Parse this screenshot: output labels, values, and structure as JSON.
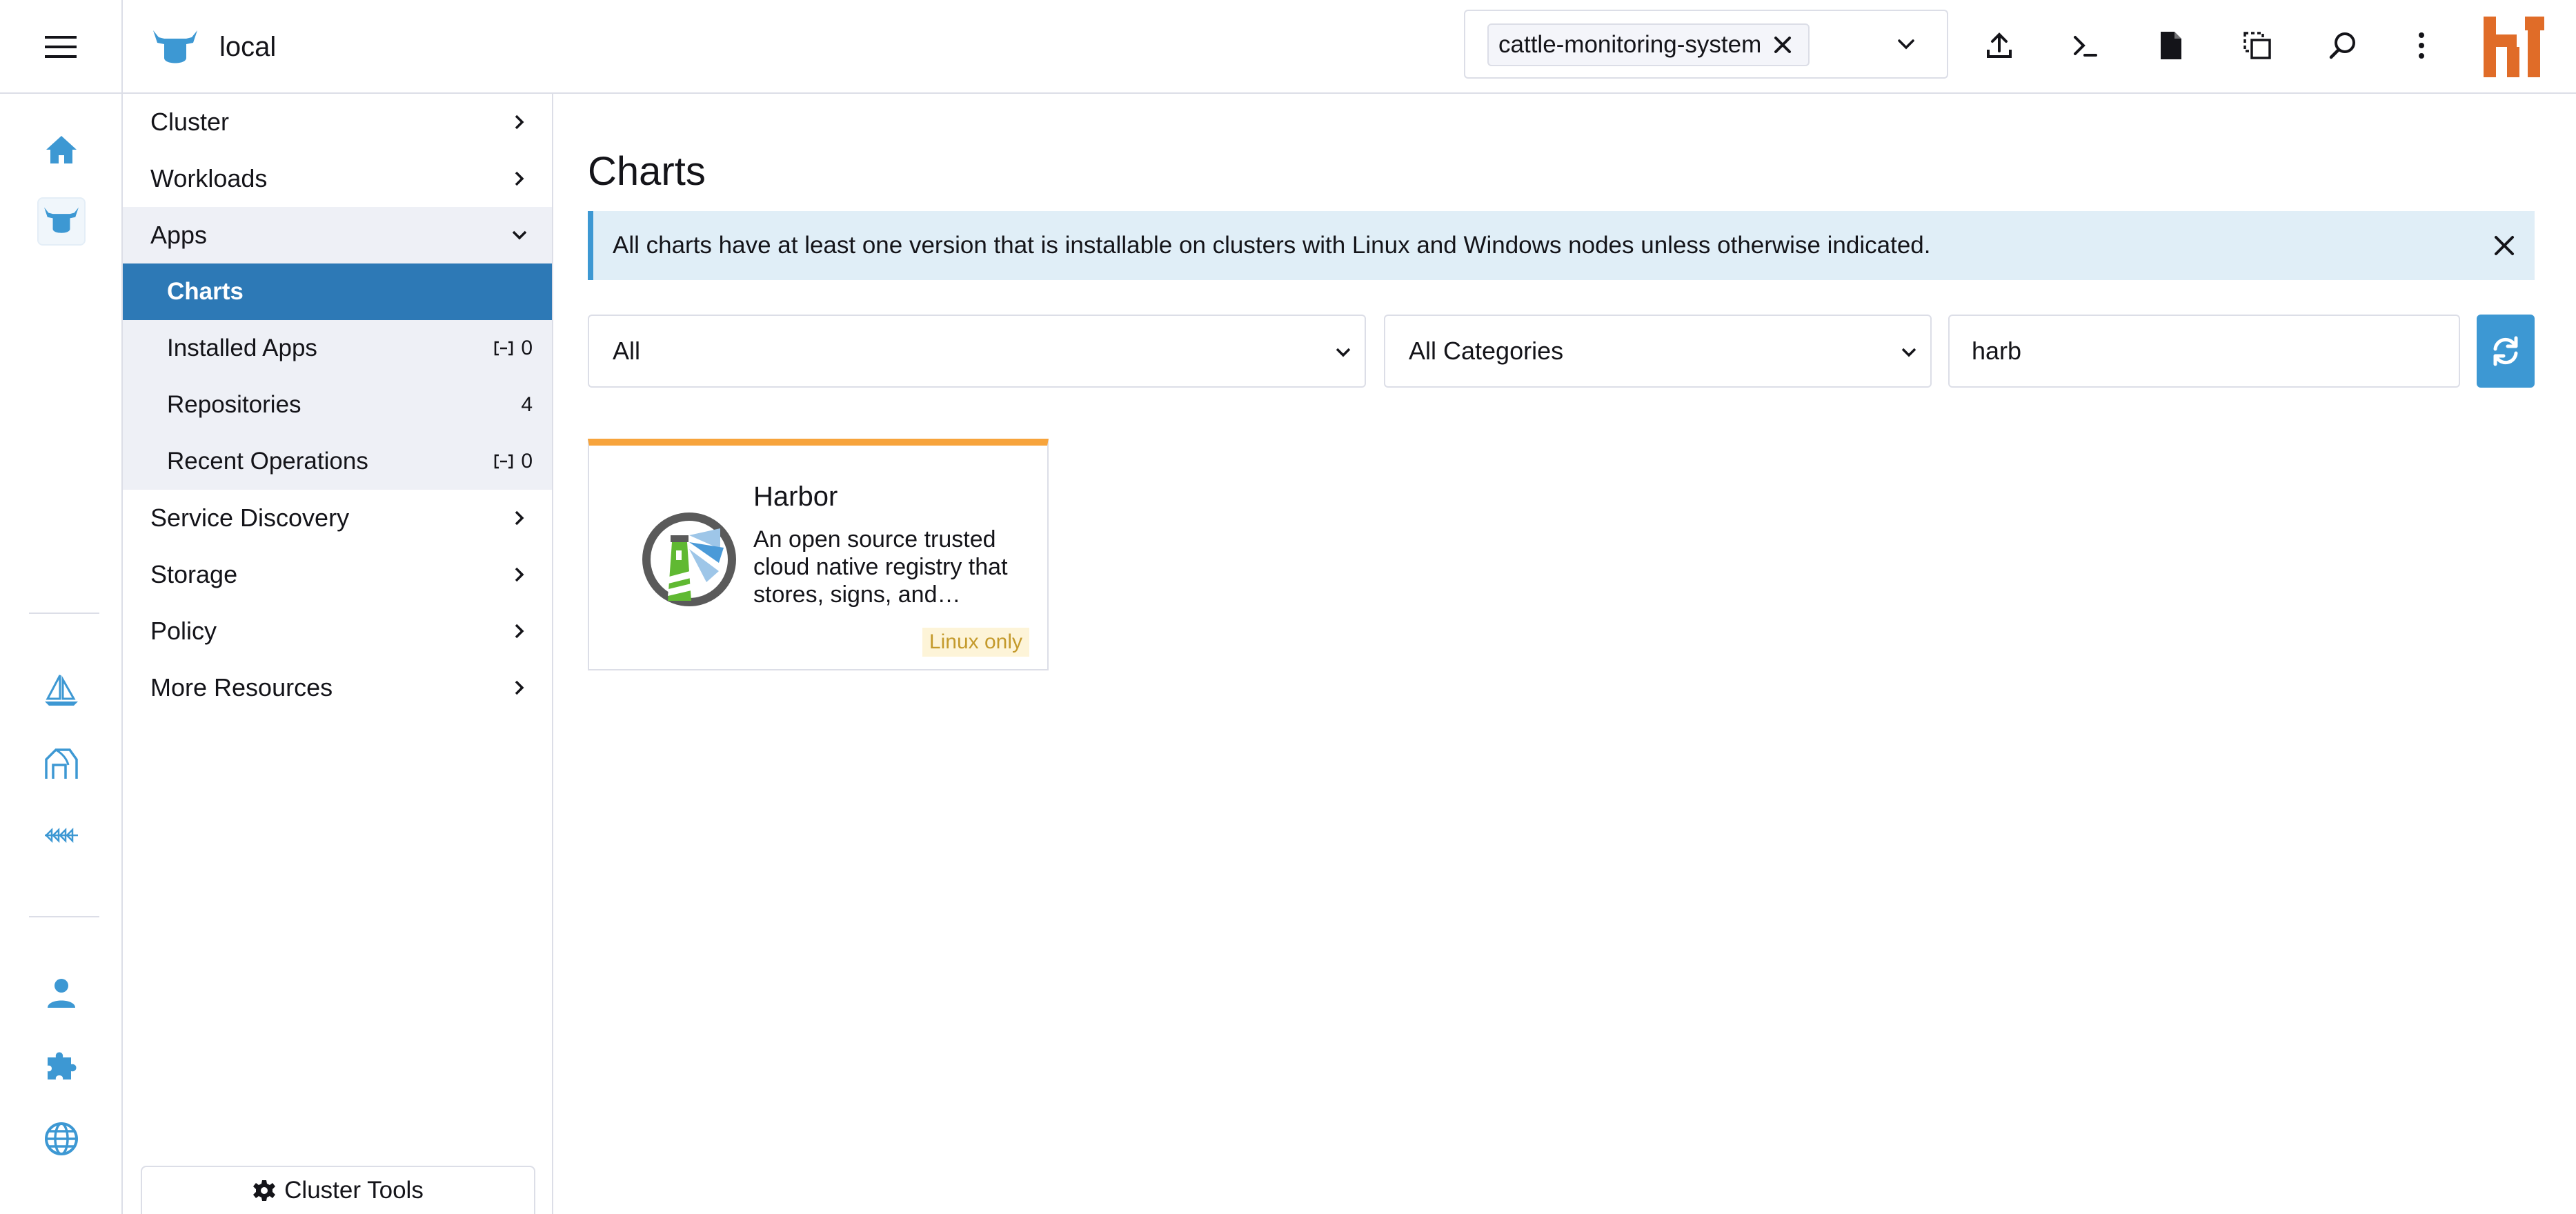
{
  "header": {
    "cluster_name": "local",
    "namespace_chip": "cattle-monitoring-system"
  },
  "sidebar": {
    "groups": [
      {
        "label": "Cluster"
      },
      {
        "label": "Workloads"
      },
      {
        "label": "Apps"
      },
      {
        "label": "Service Discovery"
      },
      {
        "label": "Storage"
      },
      {
        "label": "Policy"
      },
      {
        "label": "More Resources"
      }
    ],
    "apps_items": [
      {
        "label": "Charts"
      },
      {
        "label": "Installed Apps",
        "count": "0"
      },
      {
        "label": "Repositories",
        "count": "4"
      },
      {
        "label": "Recent Operations",
        "count": "0"
      }
    ],
    "cluster_tools": "Cluster Tools"
  },
  "main": {
    "title": "Charts",
    "banner": "All charts have at least one version that is installable on clusters with Linux and Windows nodes unless otherwise indicated.",
    "filters": {
      "repo": "All",
      "category": "All Categories",
      "search_value": "harb"
    },
    "charts": [
      {
        "name": "Harbor",
        "description": "An open source trusted cloud native registry that stores, signs, and…",
        "badge": "Linux only"
      }
    ]
  },
  "colors": {
    "accent": "#3d98d3",
    "active_nav": "#2d79b6",
    "card_top": "#f7a43c",
    "banner_bg": "#e0eef7",
    "avatar": "#e06c28"
  },
  "icons": {
    "rail": [
      "home-icon",
      "cluster-bull-icon",
      "fleet-sailboat-icon",
      "vm-barn-icon",
      "neuvector-icon",
      "user-icon",
      "extensions-puzzle-icon",
      "globe-icon"
    ],
    "header": [
      "import-yaml-icon",
      "kubectl-shell-icon",
      "kubeconfig-download-icon",
      "copy-kubeconfig-icon",
      "resource-search-icon",
      "more-vertical-icon"
    ]
  }
}
